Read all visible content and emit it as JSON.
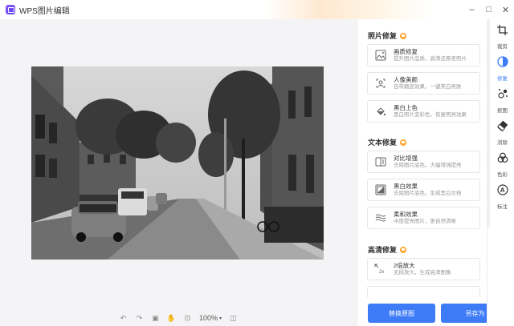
{
  "window": {
    "title": "WPS图片编辑",
    "controls": [
      "–",
      "□",
      "✕"
    ]
  },
  "toolbar": {
    "zoom": "100%"
  },
  "panel": {
    "sections": [
      {
        "title": "照片修复",
        "items": [
          {
            "title": "画质修复",
            "desc": "提升图片品质，高清还原老照片",
            "icon": "image-enhance-icon"
          },
          {
            "title": "人像美颜",
            "desc": "自带磨皮效果，一键美白亮肤",
            "icon": "portrait-beauty-icon"
          },
          {
            "title": "黑白上色",
            "desc": "黑白照片变彩色，恢复明亮效果",
            "icon": "colorize-icon"
          }
        ]
      },
      {
        "title": "文本修复",
        "items": [
          {
            "title": "对比增强",
            "desc": "去除图片底色，大幅增强提亮",
            "icon": "contrast-icon"
          },
          {
            "title": "黑白效果",
            "desc": "去除图片底色，生成黑白文档",
            "icon": "bw-effect-icon"
          },
          {
            "title": "柔和效果",
            "desc": "中度提亮图片，更自然清晰",
            "icon": "soft-effect-icon"
          }
        ]
      },
      {
        "title": "高清修复",
        "items": [
          {
            "title": "2倍放大",
            "desc": "无损放大，生成高清图像",
            "icon": "upscale-2x-icon"
          }
        ]
      }
    ],
    "replace_label": "替换原图",
    "save_as_label": "另存为"
  },
  "rail": [
    {
      "label": "裁剪",
      "icon": "crop-icon"
    },
    {
      "label": "修复",
      "icon": "repair-icon",
      "active": true
    },
    {
      "label": "抠图",
      "icon": "cutout-icon"
    },
    {
      "label": "消除",
      "icon": "eraser-icon"
    },
    {
      "label": "色彩",
      "icon": "color-icon"
    },
    {
      "label": "标注",
      "icon": "annotate-icon"
    }
  ],
  "colors": {
    "accent": "#3d7bf7",
    "premium": "#ffa52a"
  }
}
